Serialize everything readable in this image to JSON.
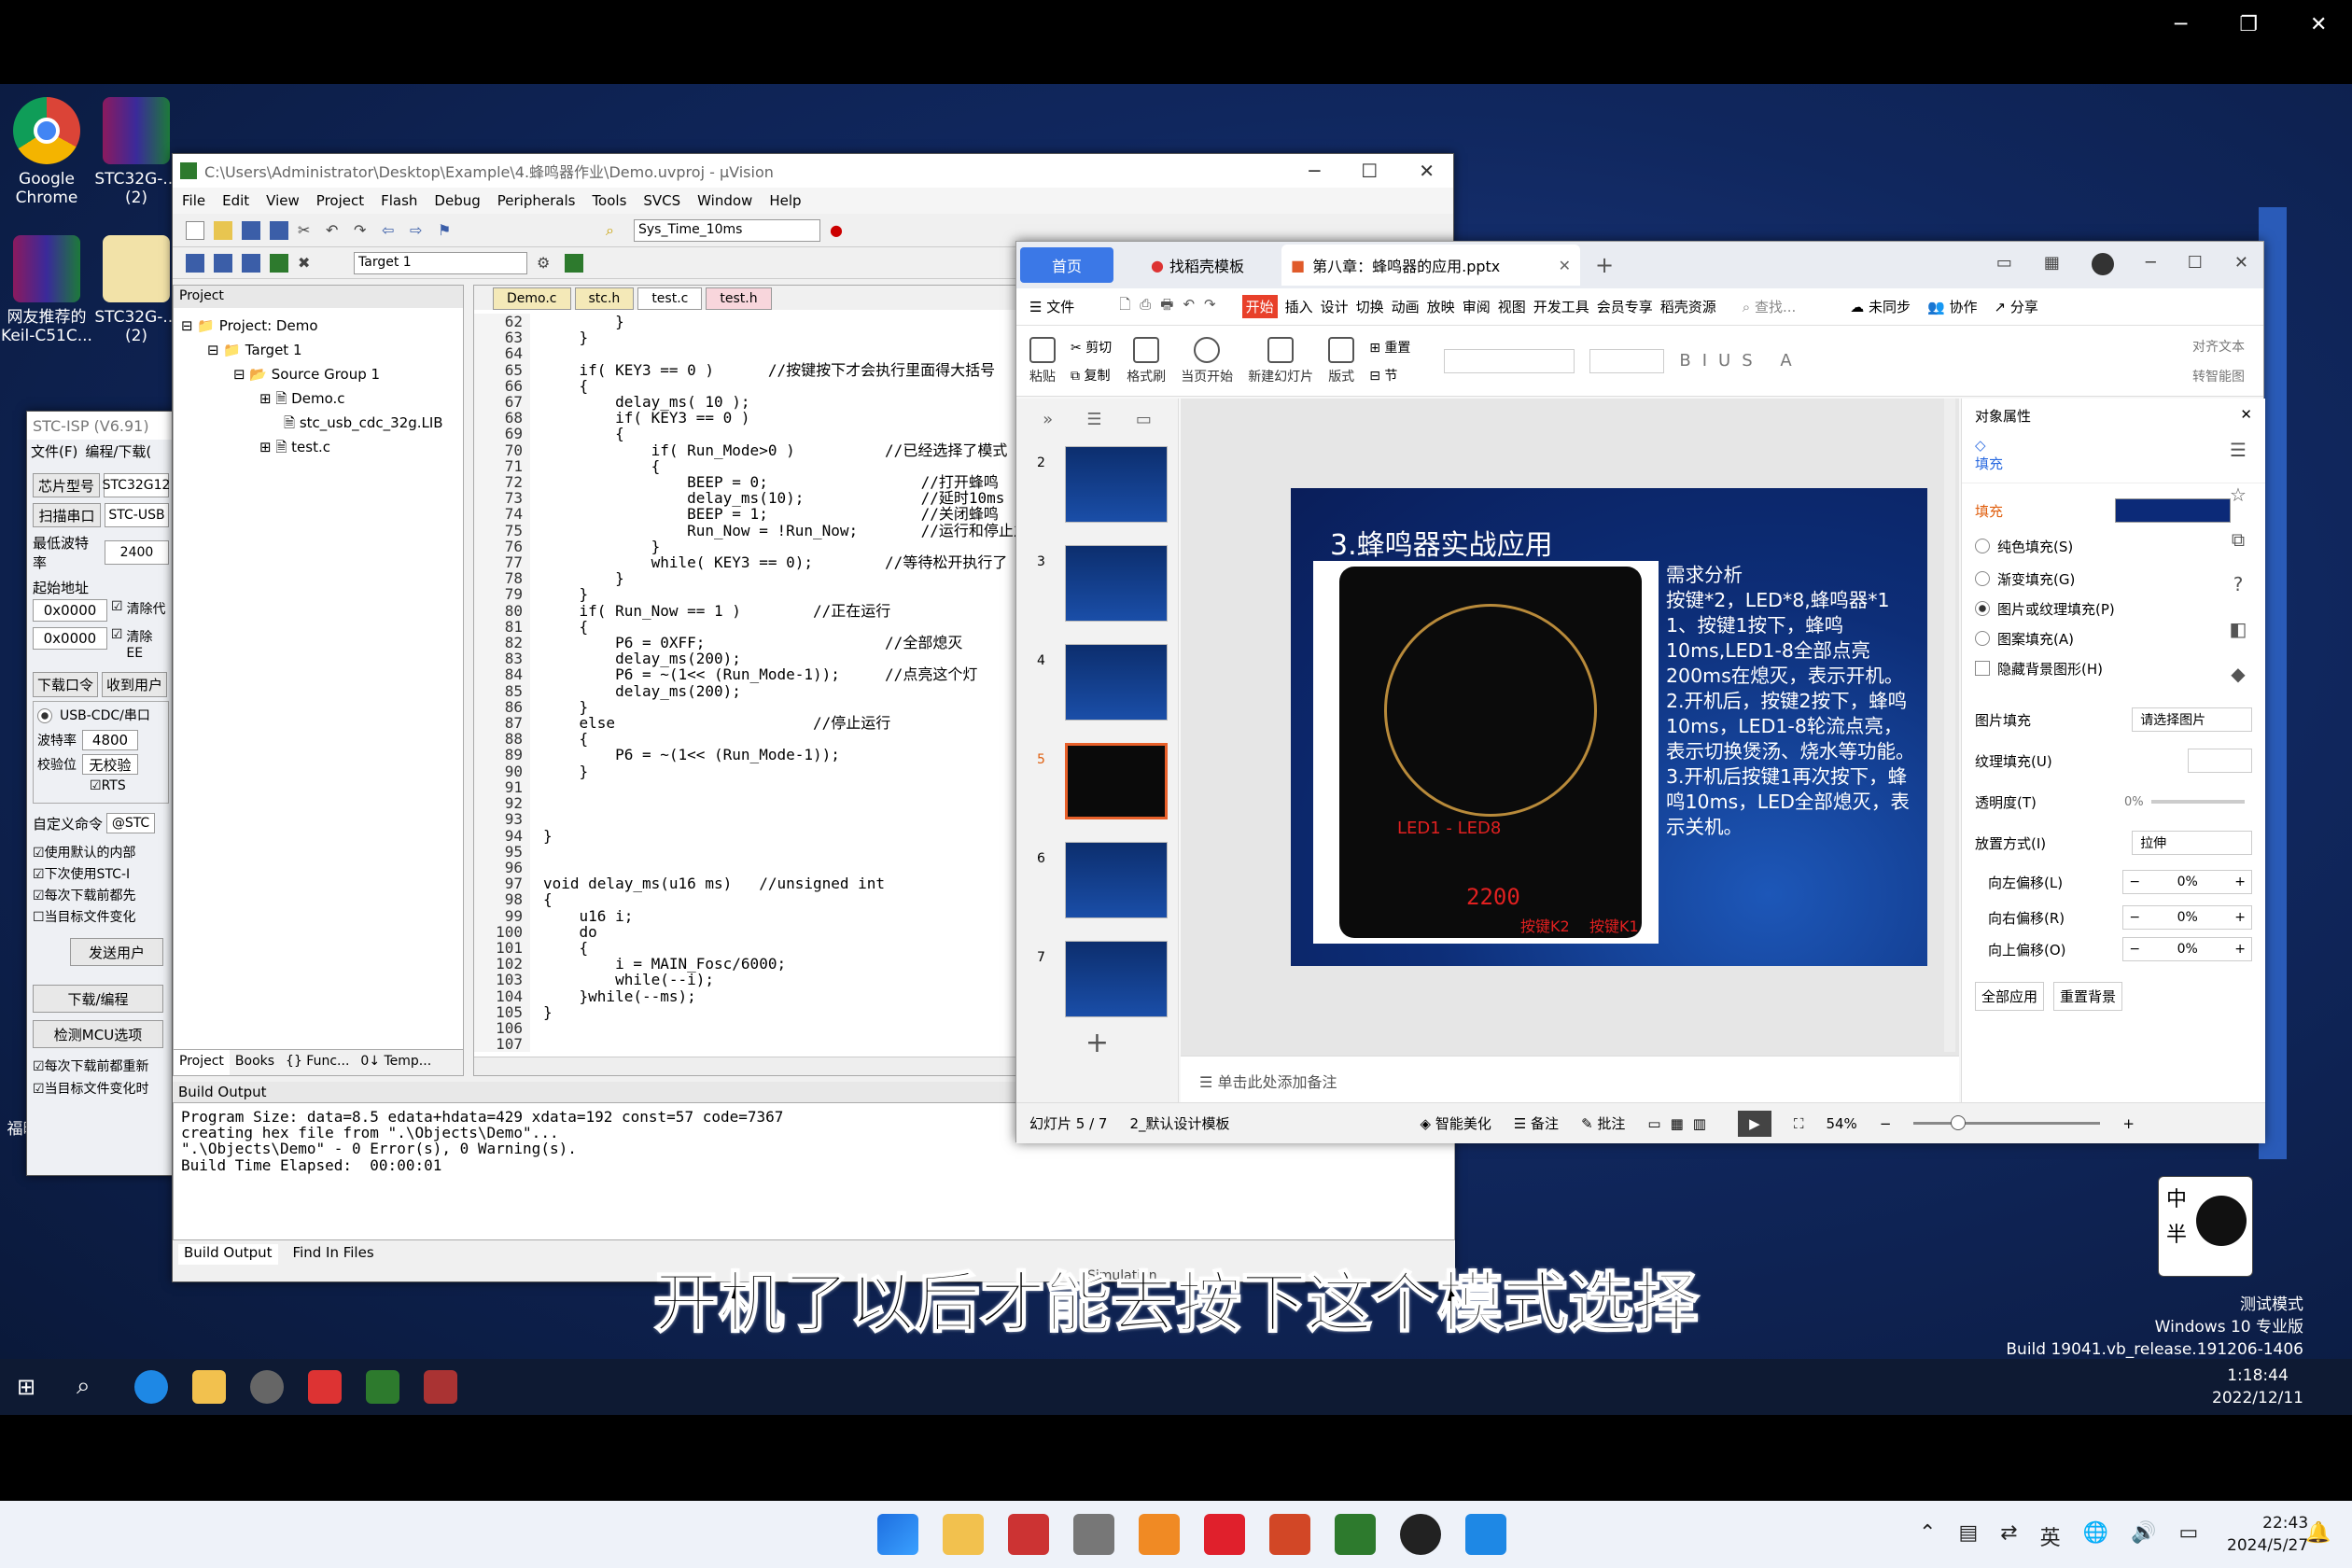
{
  "desktop": {
    "icons": [
      {
        "label": "Google Chrome"
      },
      {
        "label": "STC32G-... (2)"
      },
      {
        "label": "网友推荐的 Keil-C51C..."
      },
      {
        "label": "STC32G-... (2)"
      },
      {
        "label": "福昕阅读器"
      }
    ],
    "watermark": {
      "line1": "测试模式",
      "line2": "Windows 10 专业版",
      "line3": "Build 19041.vb_release.191206-1406",
      "time": "1:18:44",
      "date": "2022/12/11"
    }
  },
  "keil": {
    "title": "C:\\Users\\Administrator\\Desktop\\Example\\4.蜂鸣器作业\\Demo.uvproj - µVision",
    "menu": [
      "File",
      "Edit",
      "View",
      "Project",
      "Flash",
      "Debug",
      "Peripherals",
      "Tools",
      "SVCS",
      "Window",
      "Help"
    ],
    "toolbar_combo": "Sys_Time_10ms",
    "target_combo": "Target 1",
    "project_panel_title": "Project",
    "tree": [
      "Project: Demo",
      "Target 1",
      "Source Group 1",
      "Demo.c",
      "stc_usb_cdc_32g.LIB",
      "test.c"
    ],
    "panel_tabs": [
      "Project",
      "Books",
      "{} Func...",
      "0↓ Temp..."
    ],
    "editor_tabs": [
      "Demo.c",
      "stc.h",
      "test.c",
      "test.h"
    ],
    "line_numbers": "62\n63\n64\n65\n66\n67\n68\n69\n70\n71\n72\n73\n74\n75\n76\n77\n78\n79\n80\n81\n82\n83\n84\n85\n86\n87\n88\n89\n90\n91\n92\n93\n94\n95\n96\n97\n98\n99\n100\n101\n102\n103\n104\n105\n106\n107",
    "code": "        }\n    }\n\n    if( KEY3 == 0 )      //按键按下才会执行里面得大括号\n    {\n        delay_ms( 10 );\n        if( KEY3 == 0 )\n        {\n            if( Run_Mode>0 )          //已经选择了模式\n            {\n                BEEP = 0;                 //打开蜂鸣\n                delay_ms(10);             //延时10ms\n                BEEP = 1;                 //关闭蜂鸣\n                Run_Now = !Run_Now;       //运行和停止之间\n            }\n            while( KEY3 == 0);        //等待松开执行了\n        }\n    }\n    if( Run_Now == 1 )        //正在运行\n    {\n        P6 = 0XFF;                    //全部熄灭\n        delay_ms(200);\n        P6 = ~(1<< (Run_Mode-1));     //点亮这个灯\n        delay_ms(200);\n    }\n    else                      //停止运行\n    {\n        P6 = ~(1<< (Run_Mode-1));\n    }\n\n\n\n}\n\n\nvoid delay_ms(u16 ms)   //unsigned int\n{\n    u16 i;\n    do\n    {\n        i = MAIN_Fosc/6000;\n        while(--i);\n    }while(--ms);\n}\n",
    "build_title": "Build Output",
    "build_lines": [
      "Program Size: data=8.5 edata+hdata=429 xdata=192 const=57 code=7367",
      "creating hex file from \".\\Objects\\Demo\"...",
      "\".\\Objects\\Demo\" - 0 Error(s), 0 Warning(s).",
      "Build Time Elapsed:  00:00:01"
    ],
    "build_tabs": [
      "Build Output",
      "Find In Files"
    ],
    "status_fragment": "Simulation"
  },
  "stcisp": {
    "title": "STC-ISP (V6.91)",
    "menu": [
      "文件(F)",
      "编程/下载("
    ],
    "rows": [
      {
        "label": "芯片型号",
        "value": "STC32G12"
      },
      {
        "label": "扫描串口",
        "value": "STC-USB"
      },
      {
        "label": "最低波特率",
        "value": "2400"
      }
    ],
    "addr_label": "起始地址",
    "addr1": "0x0000",
    "addr2": "0x0000",
    "chk1": "清除代",
    "chk2": "清除EE",
    "tabs": [
      "下载口令",
      "收到用户"
    ],
    "usb_option": "USB-CDC/串口",
    "baud_label": "波特率",
    "baud_value": "4800",
    "parity_label": "校验位",
    "parity_value": "无校验",
    "rts": "RTS",
    "custom_cmd": "自定义命令",
    "custom_val": "@STC",
    "options": [
      "使用默认的内部",
      "下次使用STC-I",
      "每次下载前都先",
      "当目标文件变化"
    ],
    "send_btn": "发送用户",
    "download_btn": "下载/编程",
    "detect_btn": "检测MCU选项",
    "bottom_chk": [
      "每次下载前都重新",
      "当目标文件变化时"
    ]
  },
  "wps": {
    "tab_home": "首页",
    "tab_template": "找稻壳模板",
    "tab_doc": "第八章：蜂鸣器的应用.pptx",
    "menu_file": "文件",
    "ribbon_tabs": [
      "开始",
      "插入",
      "设计",
      "切换",
      "动画",
      "放映",
      "审阅",
      "视图",
      "开发工具",
      "会员专享",
      "稻壳资源"
    ],
    "search": "查找...",
    "sync": "未同步",
    "collab": "协作",
    "share": "分享",
    "ribbon_items": [
      "粘贴",
      "剪切",
      "复制",
      "格式刷",
      "当页开始",
      "新建幻灯片",
      "版式",
      "重置",
      "节"
    ],
    "align_text": "对齐文本",
    "convert": "转智能图",
    "slide_numbers": [
      "2",
      "3",
      "4",
      "5",
      "6",
      "7"
    ],
    "slide": {
      "title": "3.蜂鸣器实战应用",
      "body": "需求分析\n按键*2，LED*8,蜂鸣器*1\n1、按键1按下，蜂鸣10ms,LED1-8全部点亮200ms在熄灭，表示开机。\n2.开机后，按键2按下，蜂鸣10ms，LED1-8轮流点亮，表示切换煲汤、烧水等功能。\n3.开机后按键1再次按下，蜂鸣10ms，LED全部熄灭，表示关机。",
      "led_label": "LED1 - LED8",
      "display": "2200",
      "key2": "按键K2",
      "key1": "按键K1"
    },
    "notes": "单击此处添加备注",
    "status_slide": "幻灯片 5 / 7",
    "status_template": "2_默认设计模板",
    "smart": "智能美化",
    "notes_btn": "备注",
    "comment_btn": "批注",
    "zoom": "54%",
    "props": {
      "title": "对象属性",
      "fill_tab": "填充",
      "fill_section": "填充",
      "fill_color": "#0c2a78",
      "radios": [
        "纯色填充(S)",
        "渐变填充(G)",
        "图片或纹理填充(P)",
        "图案填充(A)"
      ],
      "hide_bg": "隐藏背景图形(H)",
      "pic_fill_label": "图片填充",
      "pic_fill_value": "请选择图片",
      "texture_label": "纹理填充(U)",
      "transparency_label": "透明度(T)",
      "transparency_value": "0%",
      "placement_label": "放置方式(I)",
      "placement_value": "拉伸",
      "offsets": [
        {
          "label": "向左偏移(L)",
          "value": "0%"
        },
        {
          "label": "向右偏移(R)",
          "value": "0%"
        },
        {
          "label": "向上偏移(O)",
          "value": "0%"
        }
      ],
      "apply_all": "全部应用",
      "reset_bg": "重置背景"
    }
  },
  "subtitle": "开机了以后才能去按下这个模式选择",
  "ime": {
    "line1": "中",
    "line2": "半"
  },
  "taskbar_inner": {
    "time": "22:43",
    "date": "2024/5/27",
    "lang": "英"
  }
}
